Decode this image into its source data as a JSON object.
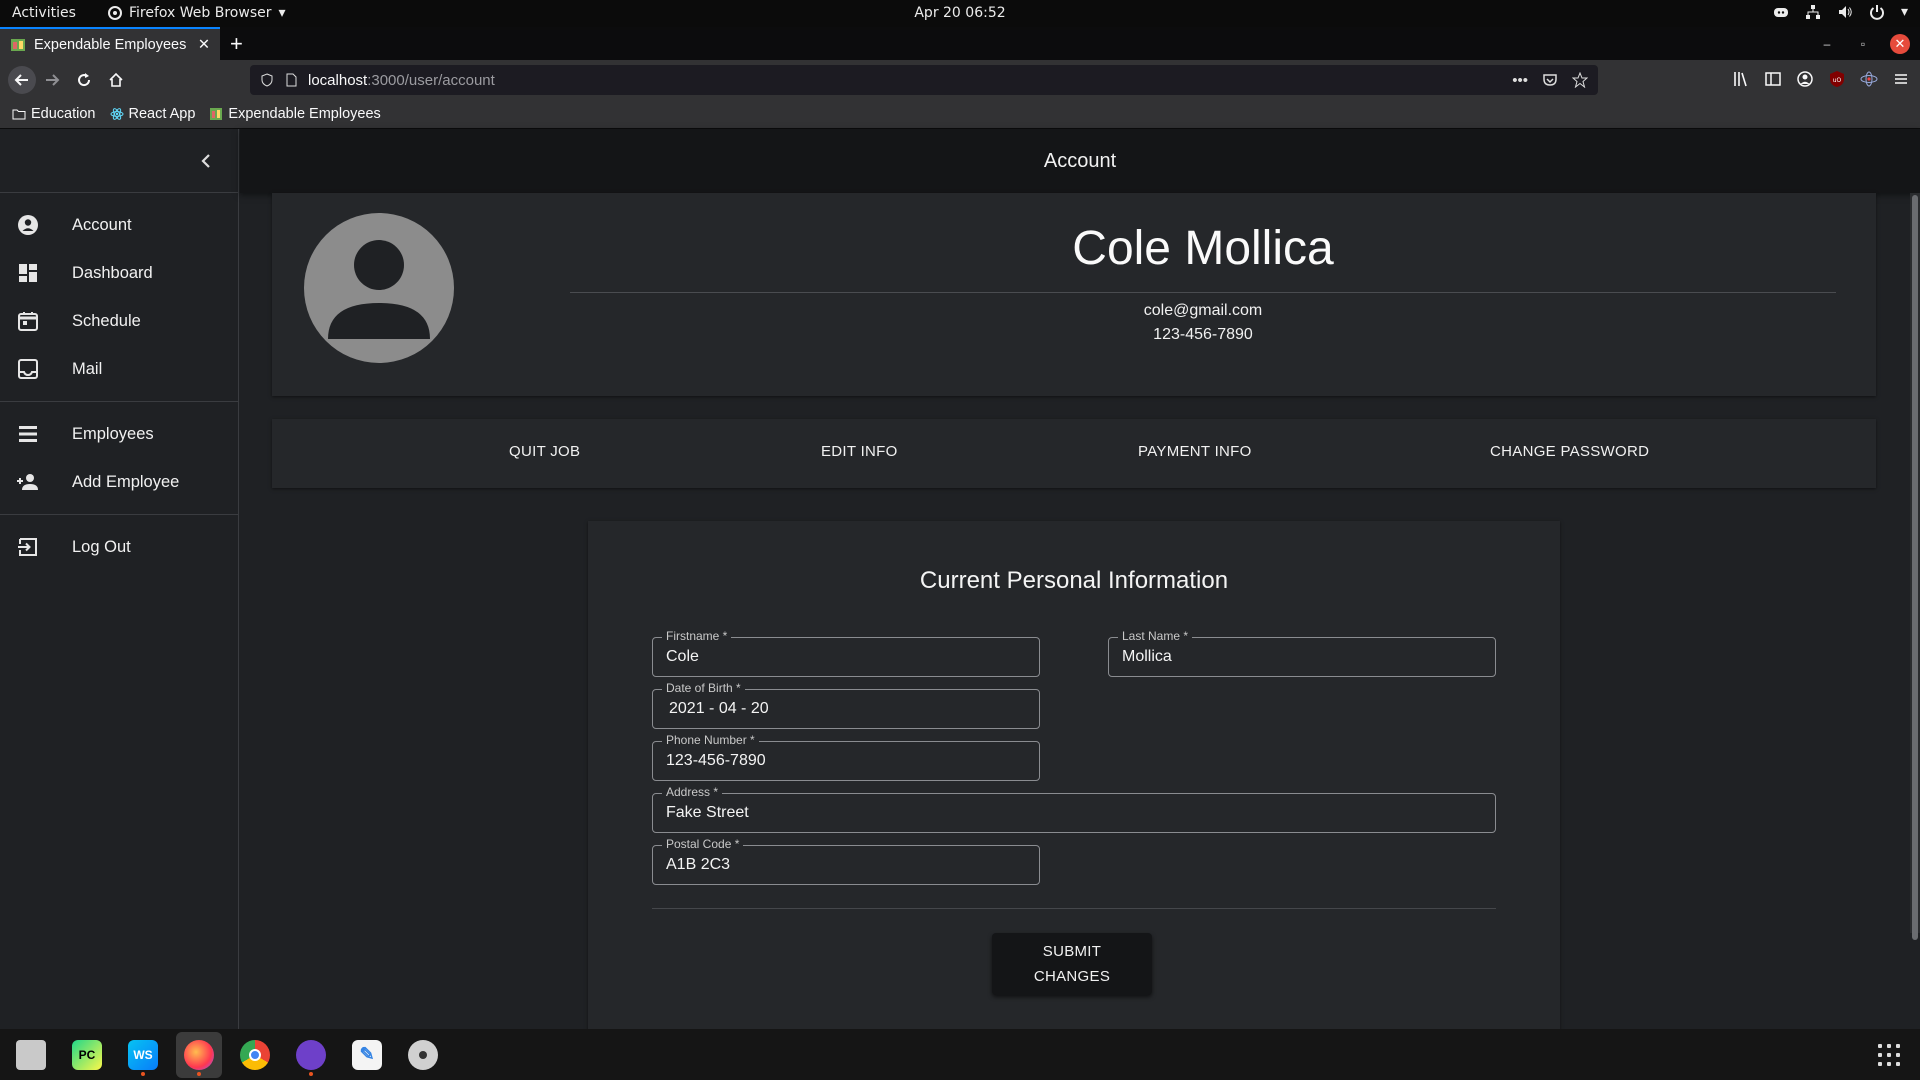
{
  "system": {
    "activities": "Activities",
    "app_menu": "Firefox Web Browser",
    "clock": "Apr 20  06:52"
  },
  "browser": {
    "tab_title": "Expendable Employees",
    "url_host": "localhost",
    "url_rest": ":3000/user/account",
    "bookmarks": [
      {
        "label": "Education",
        "icon": "folder-icon"
      },
      {
        "label": "React App",
        "icon": "react-icon"
      },
      {
        "label": "Expendable Employees",
        "icon": "favicon"
      }
    ]
  },
  "app": {
    "page_title": "Account",
    "nav": [
      {
        "label": "Account",
        "icon": "account-circle-icon"
      },
      {
        "label": "Dashboard",
        "icon": "dashboard-icon"
      },
      {
        "label": "Schedule",
        "icon": "calendar-icon"
      },
      {
        "label": "Mail",
        "icon": "inbox-icon"
      },
      {
        "label": "Employees",
        "icon": "list-icon"
      },
      {
        "label": "Add Employee",
        "icon": "person-add-icon"
      },
      {
        "label": "Log Out",
        "icon": "logout-icon"
      }
    ],
    "profile": {
      "name": "Cole Mollica",
      "email": "cole@gmail.com",
      "phone": "123-456-7890"
    },
    "actions": {
      "quit_job": "QUIT JOB",
      "edit_info": "EDIT INFO",
      "payment_info": "PAYMENT INFO",
      "change_password": "CHANGE PASSWORD"
    },
    "form": {
      "title": "Current Personal Information",
      "firstname_label": "Firstname *",
      "firstname": "Cole",
      "lastname_label": "Last Name *",
      "lastname": "Mollica",
      "dob_label": "Date of Birth *",
      "dob": "2021 - 04 - 20",
      "phone_label": "Phone Number *",
      "phone": "123-456-7890",
      "address_label": "Address *",
      "address": "Fake Street",
      "postal_label": "Postal Code *",
      "postal": "A1B 2C3",
      "submit": "SUBMIT CHANGES"
    }
  },
  "colors": {
    "accent": "#0a84ff",
    "background": "#1f2124",
    "card": "#25272a",
    "appbar": "#141517",
    "close": "#e64b3c"
  }
}
